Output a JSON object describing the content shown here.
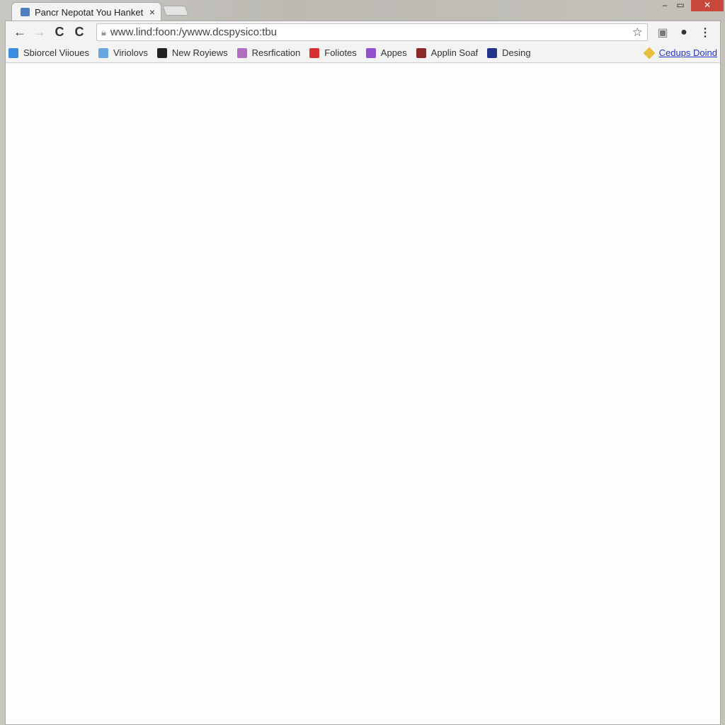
{
  "tab": {
    "title": "Pancr Nepotat You Hanket",
    "close": "×"
  },
  "window": {
    "minimize": "–",
    "maximize": "▭",
    "close": "✕"
  },
  "toolbar": {
    "back": "←",
    "forward": "→",
    "reload1": "C",
    "reload2": "C",
    "url": "www.lind:foon:/ywww.dcspysico:tbu",
    "star": "☆",
    "menu": "⋮"
  },
  "bookmarks": [
    {
      "label": "Sbiorcel Viioues",
      "icon": "bookmark-blue-icon",
      "color": "#3b8be0"
    },
    {
      "label": "Viriolovs",
      "icon": "pen-icon",
      "color": "#6aa6e0"
    },
    {
      "label": "New Royiews",
      "icon": "book-icon",
      "color": "#222222"
    },
    {
      "label": "Resrfication",
      "icon": "calendar-icon",
      "color": "#b070c0"
    },
    {
      "label": "Foliotes",
      "icon": "folio-icon",
      "color": "#d83030"
    },
    {
      "label": "Appes",
      "icon": "apps-icon",
      "color": "#9050d0"
    },
    {
      "label": "Applin Soaf",
      "icon": "cup-icon",
      "color": "#8a2a2a"
    },
    {
      "label": "Desing",
      "icon": "design-icon",
      "color": "#22358a"
    }
  ],
  "other_bookmarks": {
    "label": "Cedups Doind",
    "icon": "tag-icon",
    "color": "#e8c040"
  }
}
